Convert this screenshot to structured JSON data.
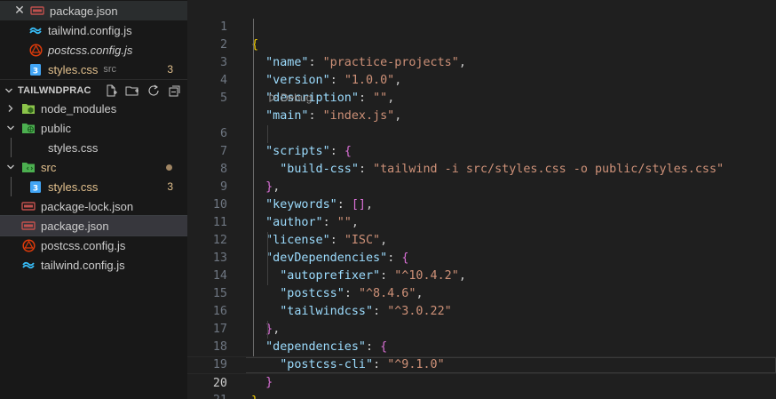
{
  "open_editors": [
    {
      "name": "package.json",
      "has_close": true
    },
    {
      "name": "tailwind.config.js"
    },
    {
      "name": "postcss.config.js"
    },
    {
      "name": "styles.css",
      "description": "src",
      "badge": "3"
    }
  ],
  "explorer": {
    "title": "TAILWNDPRAC",
    "tree": [
      {
        "name": "node_modules"
      },
      {
        "name": "public"
      },
      {
        "name": "styles.css"
      },
      {
        "name": "src"
      },
      {
        "name": "styles.css",
        "badge": "3"
      },
      {
        "name": "package-lock.json"
      },
      {
        "name": "package.json"
      },
      {
        "name": "postcss.config.js"
      },
      {
        "name": "tailwind.config.js"
      }
    ]
  },
  "editor": {
    "line_numbers": [
      "1",
      "2",
      "3",
      "4",
      "5",
      "6",
      "7",
      "8",
      "9",
      "10",
      "11",
      "12",
      "13",
      "14",
      "15",
      "16",
      "17",
      "18",
      "19",
      "20",
      "21"
    ],
    "codelens": "Debug",
    "tokens": {
      "l1_open": "{",
      "l2_key": "\"name\"",
      "l2_val": "\"practice-projects\"",
      "l3_key": "\"version\"",
      "l3_val": "\"1.0.0\"",
      "l4_key": "\"description\"",
      "l4_val": "\"\"",
      "l5_key": "\"main\"",
      "l5_val": "\"index.js\"",
      "l6_key": "\"scripts\"",
      "l6_open": "{",
      "l7_key": "\"build-css\"",
      "l7_val": "\"tailwind -i src/styles.css -o public/styles.css\"",
      "l8_close": "}",
      "l9_key": "\"keywords\"",
      "l9_val": "[]",
      "l10_key": "\"author\"",
      "l10_val": "\"\"",
      "l11_key": "\"license\"",
      "l11_val": "\"ISC\"",
      "l12_key": "\"devDependencies\"",
      "l12_open": "{",
      "l13_key": "\"autoprefixer\"",
      "l13_val": "\"^10.4.2\"",
      "l14_key": "\"postcss\"",
      "l14_val": "\"^8.4.6\"",
      "l15_key": "\"tailwindcss\"",
      "l15_val": "\"^3.0.22\"",
      "l16_close": "}",
      "l17_key": "\"dependencies\"",
      "l17_open": "{",
      "l18_key": "\"postcss-cli\"",
      "l18_val": "\"^9.1.0\"",
      "l19_close": "}",
      "l20_close": "}"
    }
  },
  "colors": {
    "json_key": "#9cdcfe",
    "json_string": "#ce9178",
    "bracket_level1": "#ffd700",
    "bracket_level2": "#da70d6",
    "modified": "#e2c08d"
  }
}
